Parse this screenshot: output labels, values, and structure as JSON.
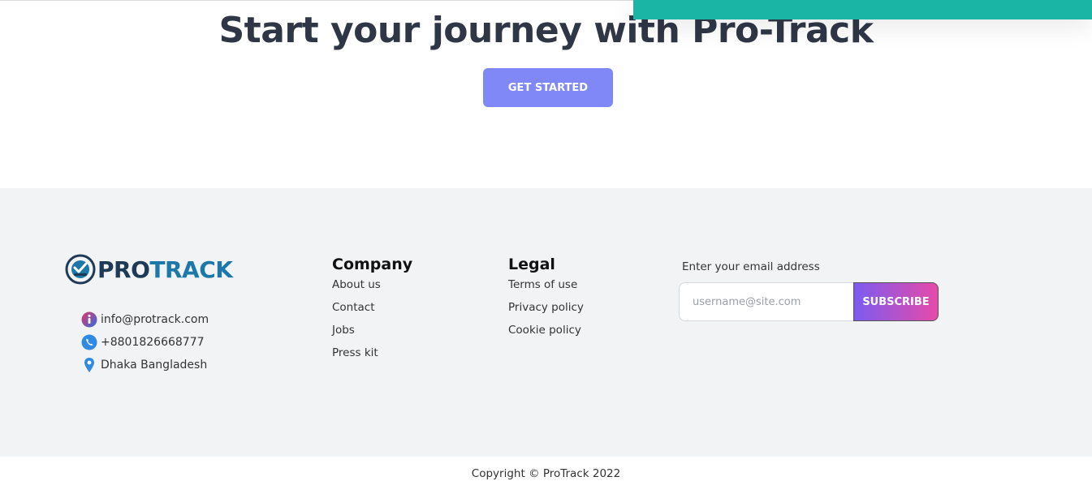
{
  "hero": {
    "title": "Start your journey with Pro-Track",
    "cta_label": "GET STARTED"
  },
  "brand": {
    "logo_text_part1": "PRO",
    "logo_text_part2": "TRACK",
    "colors": {
      "teal_banner": "#1bb5a5",
      "cta": "#8088f7",
      "logo_dark": "#1f3a55",
      "logo_blue": "#1b78a8",
      "subscribe_gradient_start": "#7b5cf0",
      "subscribe_gradient_end": "#e64aa9",
      "footer_bg": "#f2f3f5"
    }
  },
  "contact": {
    "items": [
      {
        "icon": "info-icon",
        "text": "info@protrack.com"
      },
      {
        "icon": "phone-icon",
        "text": "+8801826668777"
      },
      {
        "icon": "location-pin-icon",
        "text": "Dhaka Bangladesh"
      }
    ]
  },
  "company": {
    "title": "Company",
    "links": [
      "About us",
      "Contact",
      "Jobs",
      "Press kit"
    ]
  },
  "legal": {
    "title": "Legal",
    "links": [
      "Terms of use",
      "Privacy policy",
      "Cookie policy"
    ]
  },
  "newsletter": {
    "label": "Enter your email address",
    "placeholder": "username@site.com",
    "button_label": "SUBSCRIBE"
  },
  "copyright": "Copyright © ProTrack 2022"
}
